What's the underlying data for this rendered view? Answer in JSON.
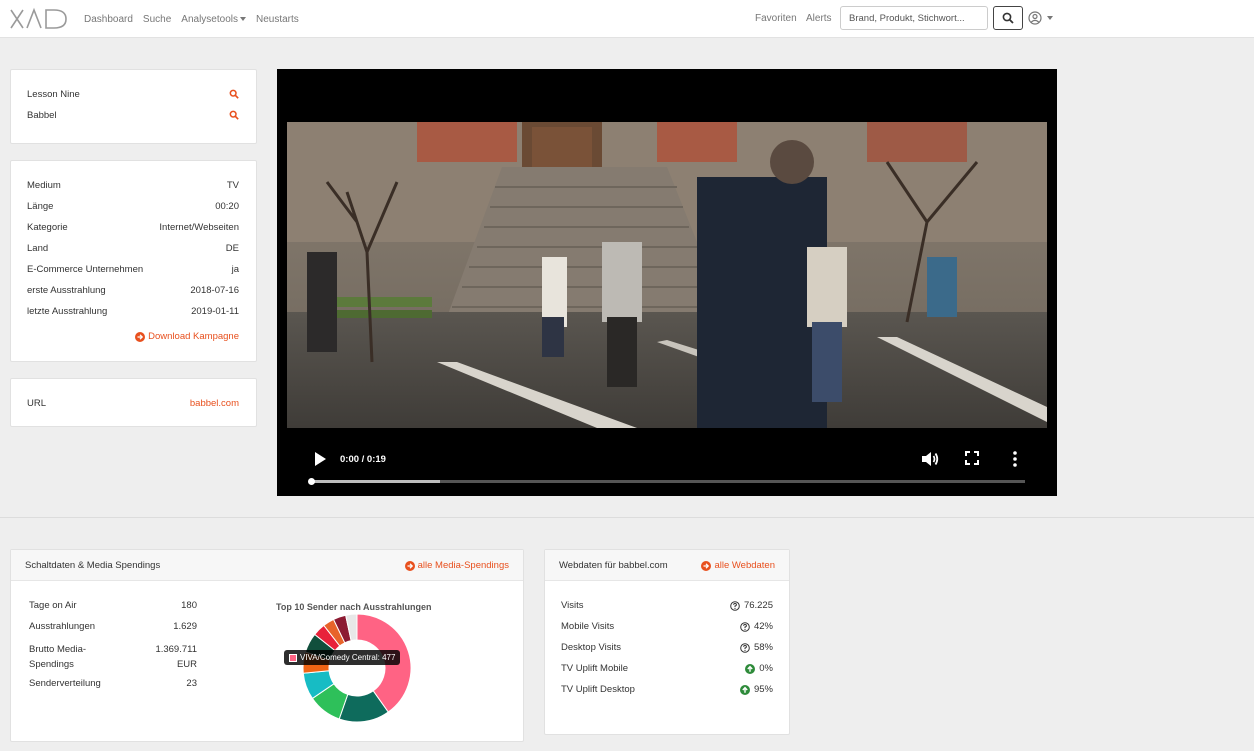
{
  "nav": {
    "logo": "XAD",
    "links": [
      "Dashboard",
      "Suche",
      "Analysetools",
      "Neustarts"
    ],
    "favorites": "Favoriten",
    "alerts": "Alerts",
    "search_placeholder": "Brand, Produkt, Stichwort..."
  },
  "brands": {
    "items": [
      {
        "label": "Lesson Nine",
        "icon": "search-icon"
      },
      {
        "label": "Babbel",
        "icon": "search-icon"
      }
    ]
  },
  "details": {
    "rows": [
      {
        "label": "Medium",
        "value": "TV"
      },
      {
        "label": "Länge",
        "value": "00:20"
      },
      {
        "label": "Kategorie",
        "value": "Internet/Webseiten"
      },
      {
        "label": "Land",
        "value": "DE"
      },
      {
        "label": "E-Commerce Unternehmen",
        "value": "ja"
      },
      {
        "label": "erste Ausstrahlung",
        "value": "2018-07-16"
      },
      {
        "label": "letzte Ausstrahlung",
        "value": "2019-01-11"
      }
    ],
    "download": "Download Kampagne"
  },
  "url": {
    "label": "URL",
    "value": "babbel.com"
  },
  "video": {
    "time": "0:00 / 0:19",
    "progress": 0.0,
    "buffered": 0.18
  },
  "spendings": {
    "title": "Schaltdaten & Media Spendings",
    "link": "alle Media-Spendings",
    "rows": [
      {
        "label": "Tage on Air",
        "value": "180"
      },
      {
        "label": "Ausstrahlungen",
        "value": "1.629"
      },
      {
        "label": "Brutto Media-Spendings",
        "value": "1.369.711 EUR"
      },
      {
        "label": "Senderverteilung",
        "value": "23"
      }
    ]
  },
  "chart_data": {
    "type": "pie",
    "title": "Top 10 Sender nach Ausstrahlungen",
    "donut": true,
    "slices": [
      {
        "name": "VIVA/Comedy Central",
        "value": 477,
        "color": "#ff6384"
      },
      {
        "value": 180,
        "color": "#0e6b5c"
      },
      {
        "value": 120,
        "color": "#2ec05a"
      },
      {
        "value": 95,
        "color": "#17bcc4"
      },
      {
        "value": 75,
        "color": "#f06414"
      },
      {
        "value": 70,
        "color": "#114f3c"
      },
      {
        "value": 45,
        "color": "#e8223a"
      },
      {
        "value": 40,
        "color": "#e8632a"
      },
      {
        "value": 45,
        "color": "#8c1a32"
      },
      {
        "value": 40,
        "color": "#e8e8e8"
      }
    ],
    "tooltip": "VIVA/Comedy Central: 477"
  },
  "webdata": {
    "title": "Webdaten für babbel.com",
    "link": "alle Webdaten",
    "rows": [
      {
        "label": "Visits",
        "value": "76.225",
        "icon": "question-circle-icon"
      },
      {
        "label": "Mobile Visits",
        "value": "42%",
        "icon": "question-circle-icon"
      },
      {
        "label": "Desktop Visits",
        "value": "58%",
        "icon": "question-circle-icon"
      },
      {
        "label": "TV Uplift Mobile",
        "value": "0%",
        "icon": "arrow-up-circle-icon",
        "color": "#2e8b3a"
      },
      {
        "label": "TV Uplift Desktop",
        "value": "95%",
        "icon": "arrow-up-circle-icon",
        "color": "#2e8b3a"
      }
    ]
  }
}
